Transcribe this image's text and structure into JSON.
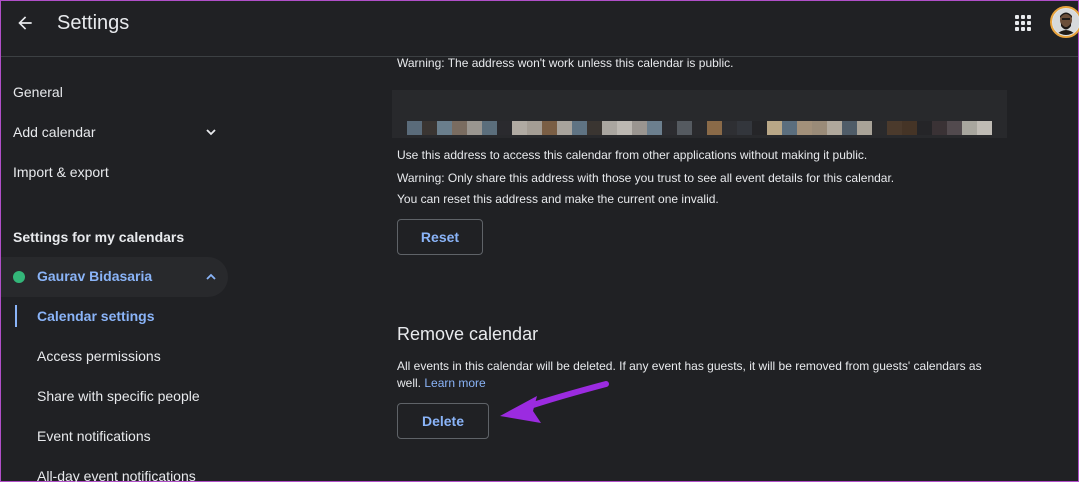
{
  "header": {
    "title": "Settings"
  },
  "sidebar": {
    "items": [
      {
        "label": "General"
      },
      {
        "label": "Add calendar"
      },
      {
        "label": "Import & export"
      }
    ],
    "section_label": "Settings for my calendars",
    "calendar": {
      "name": "Gaurav Bidasaria",
      "color": "#33b679"
    },
    "sub_items": [
      {
        "label": "Calendar settings"
      },
      {
        "label": "Access permissions"
      },
      {
        "label": "Share with specific people"
      },
      {
        "label": "Event notifications"
      },
      {
        "label": "All-day event notifications"
      }
    ]
  },
  "main": {
    "public_warning": "Warning: The address won't work unless this calendar is public.",
    "secret_info": "Use this address to access this calendar from other applications without making it public.",
    "secret_warning": "Warning: Only share this address with those you trust to see all event details for this calendar.",
    "reset_info": "You can reset this address and make the current one invalid.",
    "reset_label": "Reset",
    "remove_heading": "Remove calendar",
    "remove_desc": "All events in this calendar will be deleted. If any event has guests, it will be removed from guests' calendars as well.",
    "learn_more": "Learn more",
    "delete_label": "Delete"
  },
  "colors": {
    "background": "#202124",
    "accent": "#8ab4f8",
    "annotation_arrow": "#9b2be0"
  }
}
